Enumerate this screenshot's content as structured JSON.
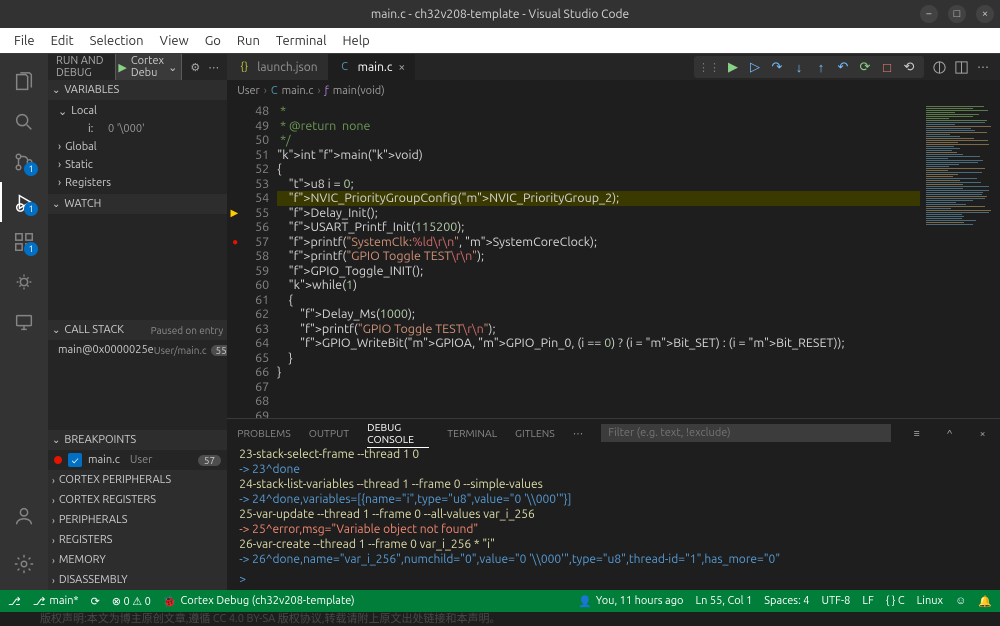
{
  "title": "main.c - ch32v208-template - Visual Studio Code",
  "menu": [
    "File",
    "Edit",
    "Selection",
    "View",
    "Go",
    "Run",
    "Terminal",
    "Help"
  ],
  "activity": {
    "badges": {
      "run": "1",
      "debug": "1",
      "ext": "1"
    }
  },
  "runDebug": {
    "header": "RUN AND DEBUG",
    "config": "Cortex Debu"
  },
  "variables": {
    "title": "VARIABLES",
    "local": "Local",
    "var_i": "i:",
    "var_i_val": "0 '\\000'",
    "global": "Global",
    "static": "Static",
    "registers": "Registers"
  },
  "watch": {
    "title": "WATCH"
  },
  "callstack": {
    "title": "CALL STACK",
    "status": "Paused on entry",
    "fn": "main@0x0000025e",
    "src": "User/main.c",
    "line": "55"
  },
  "breakpoints": {
    "title": "BREAKPOINTS",
    "entry": "main.c",
    "user": "User",
    "count": "57"
  },
  "sections": {
    "cortex_periph": "CORTEX PERIPHERALS",
    "cortex_reg": "CORTEX REGISTERS",
    "periph": "PERIPHERALS",
    "reg": "REGISTERS",
    "mem": "MEMORY",
    "dis": "DISASSEMBLY"
  },
  "tabs": {
    "launch": "launch.json",
    "main": "main.c"
  },
  "breadcrumb": {
    "user": "User",
    "file": "main.c",
    "fn": "main(void)"
  },
  "code": {
    "lines_start": 48,
    "lines": [
      " *",
      " * @return  none",
      " */",
      "int main(void)",
      "{",
      "    u8 i = 0;",
      "",
      "    NVIC_PriorityGroupConfig(NVIC_PriorityGroup_2);",
      "    Delay_Init();",
      "    USART_Printf_Init(115200);",
      "    printf(\"SystemClk:%ld\\r\\n\", SystemCoreClock);",
      "",
      "    printf(\"GPIO Toggle TEST\\r\\n\");",
      "    GPIO_Toggle_INIT();",
      "",
      "    while(1)",
      "    {",
      "        Delay_Ms(1000);",
      "        printf(\"GPIO Toggle TEST\\r\\n\");",
      "        GPIO_WriteBit(GPIOA, GPIO_Pin_0, (i == 0) ? (i = Bit_SET) : (i = Bit_RESET));",
      "    }",
      "}",
      ""
    ],
    "current_line": 55,
    "bp_line": 57
  },
  "panel": {
    "tabs": [
      "PROBLEMS",
      "OUTPUT",
      "DEBUG CONSOLE",
      "TERMINAL",
      "GITLENS"
    ],
    "more": "⋯",
    "filter_placeholder": "Filter (e.g. text, !exclude)",
    "lines": [
      {
        "t": "23-stack-select-frame --thread 1 0",
        "c": "pb-y"
      },
      {
        "t": "-> 23^done",
        "c": "pb-b"
      },
      {
        "t": "24-stack-list-variables --thread 1 --frame 0 --simple-values",
        "c": "pb-y"
      },
      {
        "t": "-> 24^done,variables=[{name=\"i\",type=\"u8\",value=\"0 '\\\\000'\"}]",
        "c": "pb-b"
      },
      {
        "t": "25-var-update --thread 1 --frame 0 --all-values var_i_256",
        "c": "pb-y"
      },
      {
        "t": "-> 25^error,msg=\"Variable object not found\"",
        "c": "pb-r"
      },
      {
        "t": "26-var-create --thread 1 --frame 0 var_i_256 * \"i\"",
        "c": "pb-y"
      },
      {
        "t": "-> 26^done,name=\"var_i_256\",numchild=\"0\",value=\"0 '\\\\000'\",type=\"u8\",thread-id=\"1\",has_more=\"0\"",
        "c": "pb-b"
      }
    ],
    "prompt": ">"
  },
  "status": {
    "branch": "main*",
    "sync": "",
    "errwarn": "",
    "debug": "Cortex Debug (ch32v208-template)",
    "blame": "You, 11 hours ago",
    "pos": "Ln 55, Col 1",
    "spaces": "Spaces: 4",
    "enc": "UTF-8",
    "eol": "LF",
    "lang": "{ } C",
    "os": "Linux"
  },
  "watermark": "版权声明:本文为博主原创文章,遵循 CC 4.0 BY-SA 版权协议,转载请附上原文出处链接和本声明。"
}
